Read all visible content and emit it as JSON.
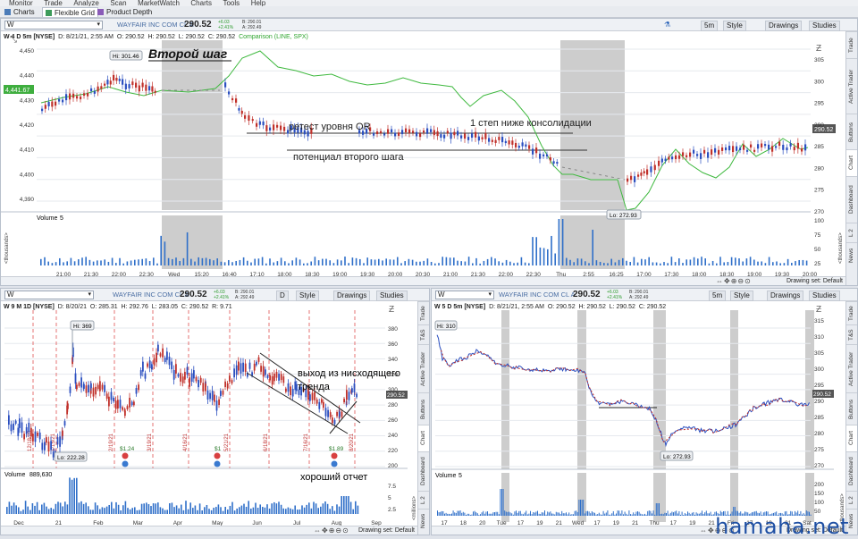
{
  "menu": [
    "Monitor",
    "Trade",
    "Analyze",
    "Scan",
    "MarketWatch",
    "Charts",
    "Tools",
    "Help"
  ],
  "tabs": {
    "charts": "Charts",
    "flexible_grid": "Flexible Grid",
    "product_depth": "Product Depth"
  },
  "top_panel": {
    "symbol": "W",
    "company": "WAYFAIR INC COM CL A",
    "price": "290.52",
    "change": "+6.03",
    "change_pct": "+2.41%",
    "bid": "B: 290.01",
    "ask": "A: 292.49",
    "timeframe_btn": "5m",
    "style_btn": "Style",
    "drawings_btn": "Drawings",
    "studies_btn": "Studies",
    "info": {
      "title": "W 4 D 5m [NYSE]",
      "date": "D: 8/21/21, 2:55 AM",
      "open": "O: 290.52",
      "high": "H: 290.52",
      "low": "L: 290.52",
      "close": "C: 290.52",
      "comparison": "Comparison (LINE, SPX)"
    },
    "hi_label": "Hi: 301.46",
    "lo_label": "Lo: 272.93",
    "left_price_tag": "4,441.67",
    "right_price_tag": "290.52",
    "left_axis": [
      "4,450",
      "4,440",
      "4,430",
      "4,420",
      "4,410",
      "4,400",
      "4,390"
    ],
    "right_axis": [
      "305",
      "300",
      "295",
      "290",
      "285",
      "280",
      "275",
      "270"
    ],
    "volume_label": "Volume",
    "volume_val": "5",
    "vol_axis": [
      "100",
      "75",
      "50",
      "25"
    ],
    "thousands": "<thousands>",
    "time_axis": [
      "21:00",
      "21:30",
      "22:00",
      "22:30",
      "Wed",
      "15:20",
      "16:40",
      "17:10",
      "18:00",
      "18:30",
      "19:00",
      "19:30",
      "20:00",
      "20:30",
      "21:00",
      "21:30",
      "22:00",
      "22:30",
      "Thu",
      "2:55",
      "16:25",
      "17:00",
      "17:30",
      "18:00",
      "18:30",
      "19:00",
      "19:30",
      "20:00"
    ],
    "annot_title": "Второй шаг",
    "annot_retest": "ретест уровня OR",
    "annot_step": "1 степ ниже консолидации",
    "annot_potential": "потенциал второго шага",
    "drawing_set": "Drawing set: Default",
    "side_tabs": [
      "Trade",
      "Active Trader",
      "Buttons",
      "Chart",
      "Dashboard",
      "L 2",
      "News"
    ]
  },
  "bl_panel": {
    "symbol": "W",
    "company": "WAYFAIR INC COM CL A",
    "price": "290.52",
    "change": "+6.03",
    "change_pct": "+2.41%",
    "bid": "B: 290.01",
    "ask": "A: 292.49",
    "timeframe_btn": "D",
    "style_btn": "Style",
    "drawings_btn": "Drawings",
    "studies_btn": "Studies",
    "info": {
      "title": "W 9 M 1D [NYSE]",
      "date": "D: 8/20/21",
      "open": "O: 285.31",
      "high": "H: 292.76",
      "low": "L: 283.05",
      "close": "C: 290.52",
      "range": "R: 9.71"
    },
    "hi_label": "Hi: 369",
    "lo_label": "Lo: 222.28",
    "price_tag": "290.52",
    "right_axis": [
      "380",
      "360",
      "340",
      "320",
      "300",
      "280",
      "260",
      "240",
      "220",
      "200"
    ],
    "earnings": [
      "$1.24",
      "$1",
      "$1.89"
    ],
    "date_marks": [
      "12/18/20",
      "1/15/21",
      "2/19/21",
      "3/19/21",
      "4/16/21",
      "5/21/21",
      "6/18/21",
      "7/16/21",
      "8/20/21"
    ],
    "volume_label": "Volume",
    "volume_val": "889,630",
    "vol_axis": [
      "7.5",
      "5",
      "2.5"
    ],
    "millions": "<millions>",
    "time_axis": [
      "Dec",
      "21",
      "Feb",
      "Mar",
      "Apr",
      "May",
      "Jun",
      "Jul",
      "Aug",
      "Sep"
    ],
    "annot_breakout": "выход из нисходящего",
    "annot_trend": "тренда",
    "annot_report": "хороший отчет",
    "drawing_set": "Drawing set: Default",
    "side_tabs": [
      "Trade",
      "T&S",
      "Active Trader",
      "Buttons",
      "Chart",
      "Dashboard",
      "L 2",
      "News"
    ]
  },
  "br_panel": {
    "symbol": "W",
    "company": "WAYFAIR INC COM CL A",
    "price": "290.52",
    "change": "+6.03",
    "change_pct": "+2.41%",
    "bid": "B: 290.01",
    "ask": "A: 292.49",
    "timeframe_btn": "5m",
    "style_btn": "Style",
    "drawings_btn": "Drawings",
    "studies_btn": "Studies",
    "info": {
      "title": "W 5 D 5m [NYSE]",
      "date": "D: 8/21/21, 2:55 AM",
      "open": "O: 290.52",
      "high": "H: 290.52",
      "low": "L: 290.52",
      "close": "C: 290.52"
    },
    "hi_label": "Hi: 310",
    "lo_label": "Lo: 272.93",
    "price_tag": "290.52",
    "right_axis": [
      "315",
      "310",
      "305",
      "300",
      "295",
      "290",
      "285",
      "280",
      "275",
      "270"
    ],
    "volume_label": "Volume",
    "volume_val": "5",
    "vol_axis": [
      "200",
      "150",
      "100",
      "50"
    ],
    "thousands": "<thousands>",
    "time_axis": [
      "17",
      "18",
      "20",
      "Tue",
      "17",
      "19",
      "21",
      "Wed",
      "17",
      "19",
      "21",
      "Thu",
      "17",
      "19",
      "21",
      "Fri",
      "17",
      "19",
      "21",
      "Sat"
    ],
    "drawing_set": "Drawing set: Default",
    "side_tabs": [
      "Trade",
      "T&S",
      "Active Trader",
      "Buttons",
      "Chart",
      "Dashboard",
      "L 2",
      "News"
    ]
  },
  "watermark": "hamaha.net",
  "colors": {
    "up": "#2b4fc0",
    "down": "#c0302a",
    "comparison": "#3fb93f",
    "shade": "#c8c8c8",
    "volume": "#2f6fc9",
    "grid": "#e6e9ee"
  }
}
